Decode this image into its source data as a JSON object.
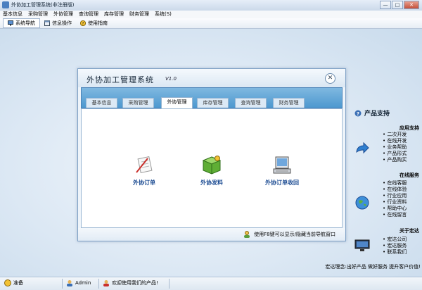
{
  "window": {
    "title": "外协加工管理系统(非注册版)",
    "buttons": {
      "minimize": "—",
      "maximize": "□",
      "close": "✕"
    }
  },
  "menu": [
    "基本信息",
    "采购管理",
    "外协管理",
    "查询管理",
    "库存管理",
    "财务管理",
    "系统(S)"
  ],
  "toolbar": [
    {
      "label": "系统导航",
      "icon": "monitor-icon",
      "active": true
    },
    {
      "label": "信息操作",
      "icon": "window-icon",
      "active": false
    },
    {
      "label": "使用指南",
      "icon": "help-icon",
      "active": false
    }
  ],
  "dialog": {
    "title": "外协加工管理系统",
    "version": "V1.0",
    "close": "✕",
    "tabs": [
      "基本信息",
      "采购管理",
      "外协管理",
      "库存管理",
      "查询管理",
      "财务管理"
    ],
    "active_tab": "外协管理",
    "functions": [
      {
        "label": "外协订单",
        "icon": "order-document-icon"
      },
      {
        "label": "外协发料",
        "icon": "material-box-icon"
      },
      {
        "label": "外协订单收回",
        "icon": "computer-receive-icon"
      }
    ],
    "hint": "使用F8键可以显示/隐藏当前导航窗口"
  },
  "product_support": {
    "title": "产品支持",
    "sections": [
      {
        "title": "应用支持",
        "items": [
          "二次开发",
          "在线开发",
          "业务帮助",
          "产品形式",
          "产品购买"
        ]
      },
      {
        "title": "在线服务",
        "items": [
          "在线客服",
          "在线体验",
          "行业应用",
          "行业资料",
          "帮助中心",
          "在线留言"
        ]
      },
      {
        "title": "关于宏达",
        "items": [
          "宏达公司",
          "宏达服务",
          "联系我们"
        ]
      }
    ],
    "slogan": "宏达理念:出好产品 做好服务 提升客户价值!"
  },
  "status": {
    "state": "准备",
    "user": "Admin",
    "welcome": "欢迎使用我们的产品!"
  },
  "colors": {
    "accent": "#4d98cf",
    "link": "#1b4b92"
  }
}
